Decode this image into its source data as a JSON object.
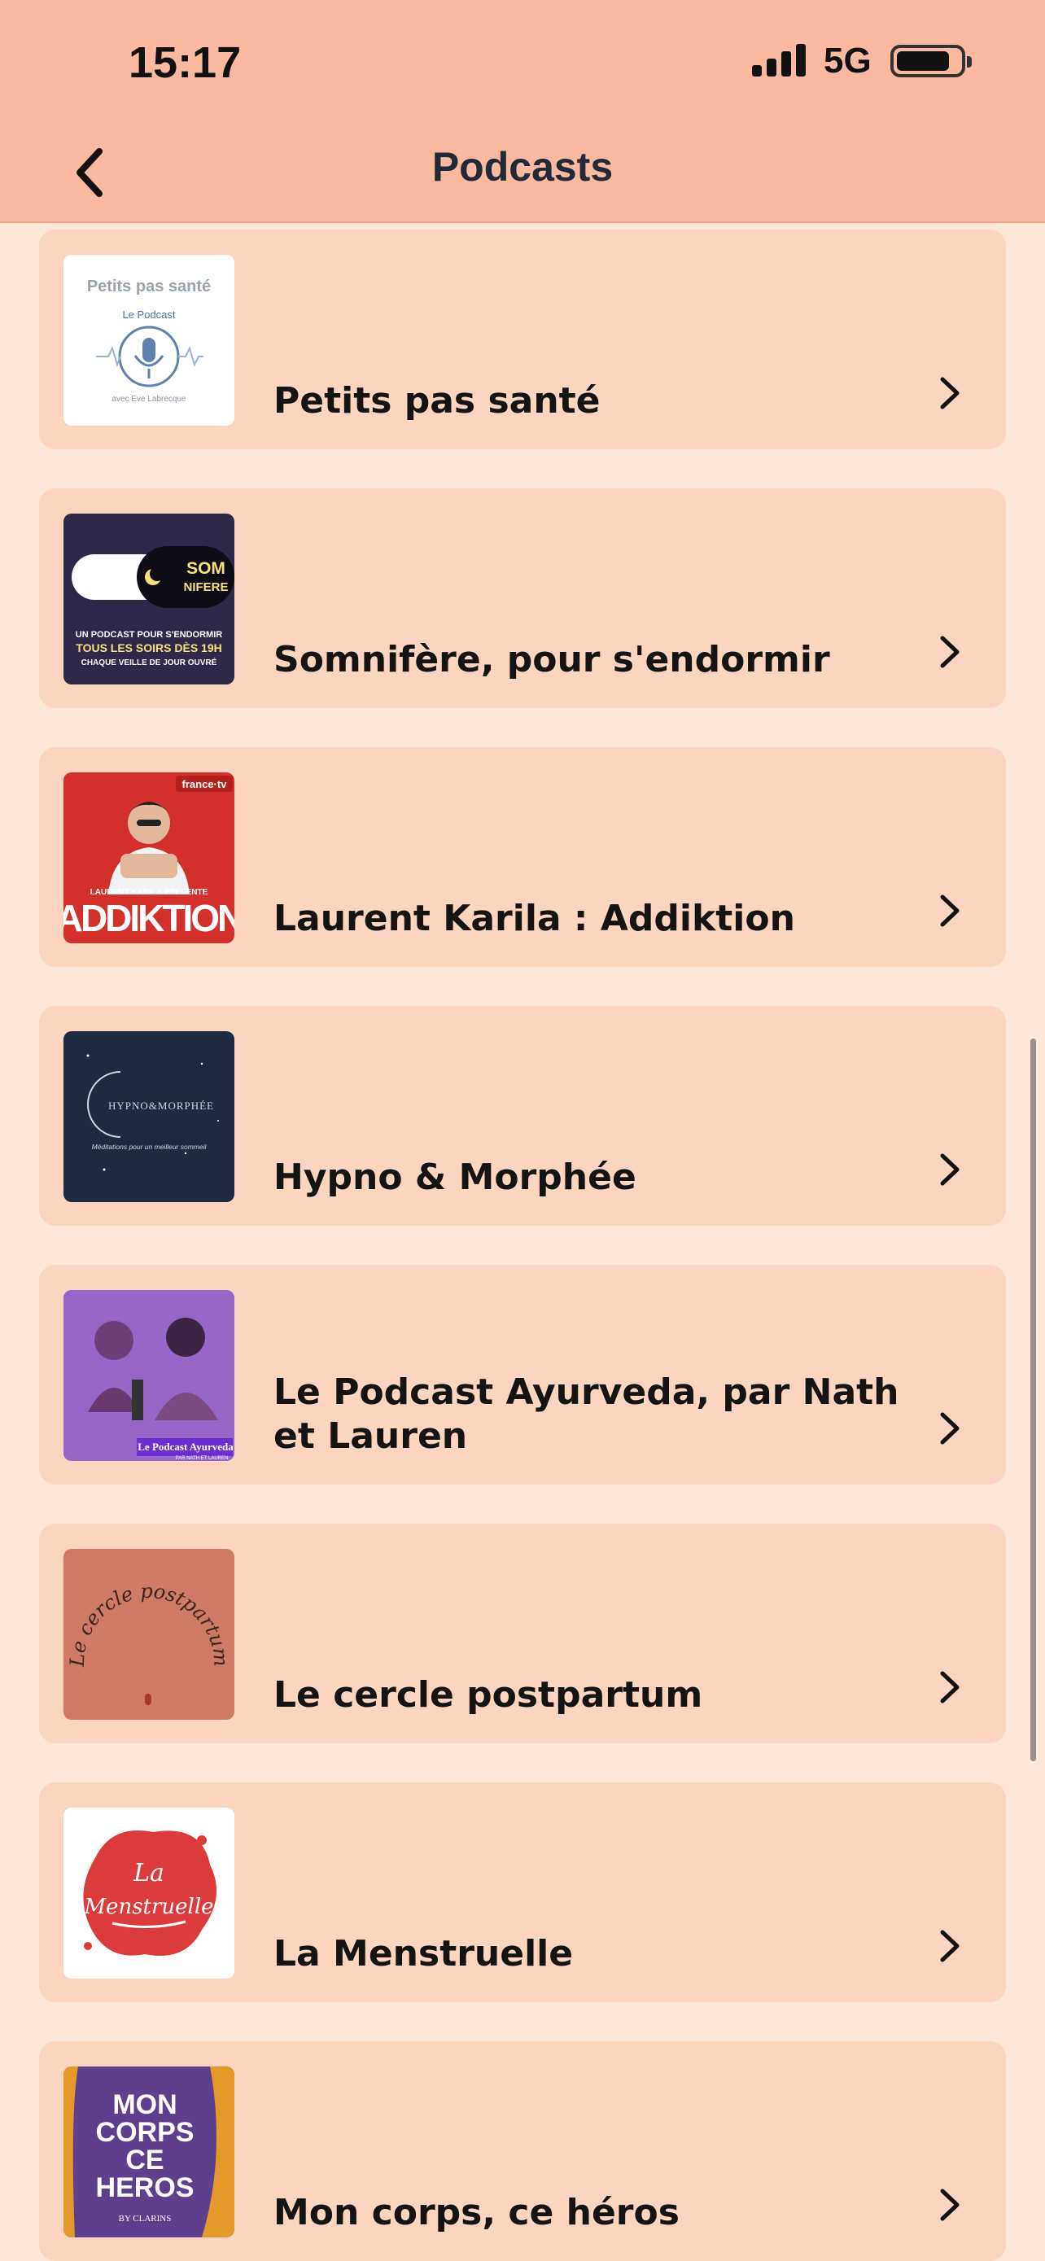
{
  "status_bar": {
    "time": "15:17",
    "network": "5G"
  },
  "nav": {
    "title": "Podcasts"
  },
  "podcasts": [
    {
      "title": "Petits pas santé",
      "artwork_text": "Petits pas santé",
      "artwork_sub": "Le Podcast",
      "artwork_author": "avec Eve Labrecque"
    },
    {
      "title": "Somnifère, pour s'endormir",
      "artwork_text": "SOM NIFERE",
      "artwork_line1": "UN PODCAST POUR S'ENDORMIR",
      "artwork_line2": "TOUS LES SOIRS DÈS 19H",
      "artwork_line3": "CHAQUE VEILLE DE JOUR OUVRÉ"
    },
    {
      "title": "Laurent Karila : Addiktion",
      "artwork_badge": "france·tv",
      "artwork_sub": "LAURENT KARILA PRÉSENTE",
      "artwork_text": "ADDIKTION"
    },
    {
      "title": "Hypno & Morphée",
      "artwork_text": "HYPNO&MORPHÉE",
      "artwork_sub": "Méditations pour un meilleur sommeil"
    },
    {
      "title": "Le Podcast Ayurveda, par Nath et Lauren",
      "artwork_text": "Le Podcast Ayurveda",
      "artwork_sub": "PAR NATH ET LAUREN"
    },
    {
      "title": "Le cercle postpartum",
      "artwork_text": "Le cercle postpartum"
    },
    {
      "title": "La Menstruelle",
      "artwork_text": "La Menstruelle"
    },
    {
      "title": "Mon corps, ce héros",
      "artwork_text": "MON CORPS CE HEROS",
      "artwork_sub": "BY CLARINS"
    }
  ],
  "colors": {
    "header_bg": "#fbb9a0",
    "page_bg": "#fde6da",
    "card_bg": "#fcd5c0"
  },
  "icons": {
    "back": "chevron-left-icon",
    "row": "chevron-right-icon"
  }
}
